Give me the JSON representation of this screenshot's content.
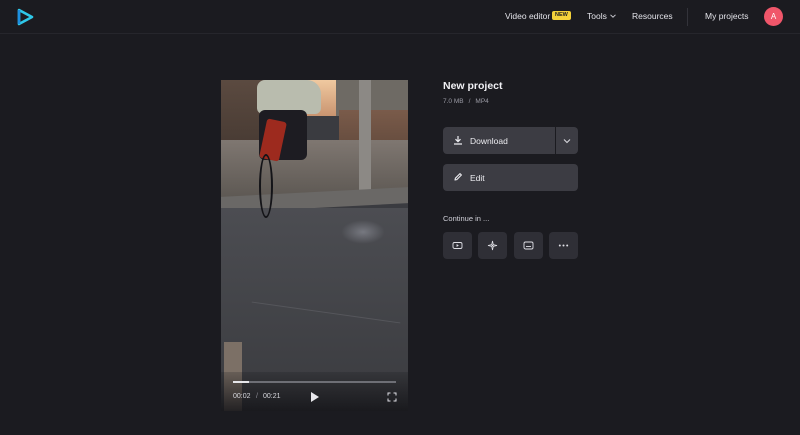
{
  "header": {
    "nav": {
      "video_editor": "Video editor",
      "video_editor_badge": "NEW",
      "tools": "Tools",
      "resources": "Resources",
      "my_projects": "My projects"
    },
    "avatar_initial": "A",
    "avatar_color": "#f0566a",
    "logo_icon": "play-triangle-logo"
  },
  "player": {
    "current_time": "00:02",
    "time_separator": "/",
    "duration": "00:21",
    "progress": 0.1
  },
  "project": {
    "title": "New project",
    "size": "7.0 MB",
    "meta_separator": "/",
    "format": "MP4"
  },
  "actions": {
    "download_label": "Download",
    "edit_label": "Edit",
    "continue_label": "Continue in ...",
    "continue_icons": [
      "youtube-icon",
      "sparkle-icon",
      "subtitles-icon",
      "more-icon"
    ]
  },
  "colors": {
    "background": "#1b1b20",
    "button": "#3c3c43",
    "badge": "#f4d23a",
    "accent_logo": "#2fc8e8"
  }
}
